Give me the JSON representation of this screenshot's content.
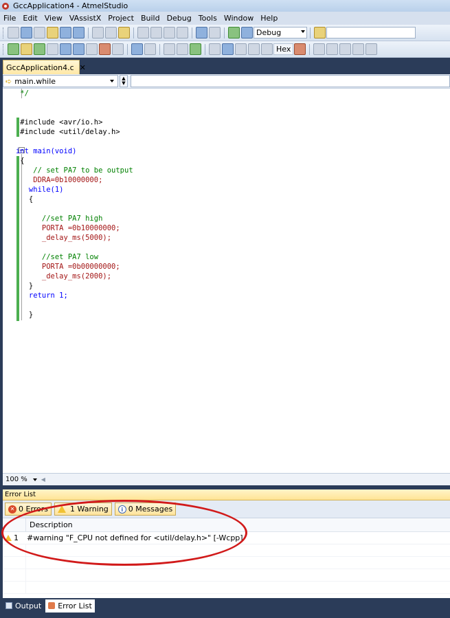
{
  "window": {
    "title": "GccApplication4 - AtmelStudio"
  },
  "menu": [
    "File",
    "Edit",
    "View",
    "VAssistX",
    "Project",
    "Build",
    "Debug",
    "Tools",
    "Window",
    "Help"
  ],
  "toolbar": {
    "config_value": "Debug",
    "hex_label": "Hex"
  },
  "tabs": {
    "active_file": "GccApplication4.c",
    "close_glyph": "✕"
  },
  "nav": {
    "function_value": "main.while"
  },
  "code": [
    "    */",
    "",
    "",
    "    #include <avr/io.h>",
    "    #include <util/delay.h>",
    "",
    "   int main(void)",
    "    {",
    "       // set PA7 to be output",
    "       DDRA=0b10000000;",
    "      while(1)",
    "      {",
    "",
    "         //set PA7 high",
    "         PORTA =0b10000000;",
    "         _delay_ms(5000);",
    "",
    "         //set PA7 low",
    "         PORTA =0b00000000;",
    "         _delay_ms(2000);",
    "      }",
    "      return 1;",
    "",
    "      }"
  ],
  "zoom": {
    "level": "100 %"
  },
  "error_list": {
    "title": "Error List",
    "filters": {
      "errors": "0 Errors",
      "warnings": "1 Warning",
      "messages": "0 Messages"
    },
    "column_description": "Description",
    "rows": [
      {
        "index": "1",
        "description": "#warning \"F_CPU not defined for <util/delay.h>\" [-Wcpp]"
      }
    ]
  },
  "bottom_tabs": {
    "output": "Output",
    "error_list": "Error List"
  },
  "colors": {
    "annotation": "#d11a1a",
    "chrome": "#2b3c59",
    "accent_tab": "#ffe8a6",
    "keyword": "#0000ff",
    "comment": "#008000",
    "macro": "#a31515"
  }
}
